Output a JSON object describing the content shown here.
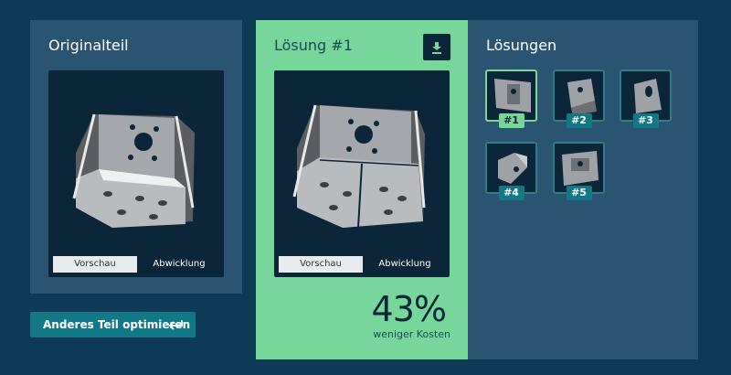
{
  "original": {
    "title": "Originalteil",
    "toggle": {
      "preview": "Vorschau",
      "unfold": "Abwicklung"
    }
  },
  "solution": {
    "title": "Lösung #1",
    "download_icon": "download-icon",
    "toggle": {
      "preview": "Vorschau",
      "unfold": "Abwicklung"
    },
    "savings_percent": "43%",
    "savings_label": "weniger Kosten"
  },
  "solutions": {
    "title": "Lösungen",
    "items": [
      {
        "label": "#1",
        "selected": true
      },
      {
        "label": "#2",
        "selected": false
      },
      {
        "label": "#3",
        "selected": false
      },
      {
        "label": "#4",
        "selected": false
      },
      {
        "label": "#5",
        "selected": false
      }
    ]
  },
  "actions": {
    "optimize_other_label": "Anderes Teil optimieren",
    "optimize_other_icon": "return-arrow-icon"
  },
  "colors": {
    "background": "#0f3a55",
    "panel": "#2b5470",
    "accent": "#77d79a",
    "button": "#137886",
    "viewer": "#0b2638"
  }
}
